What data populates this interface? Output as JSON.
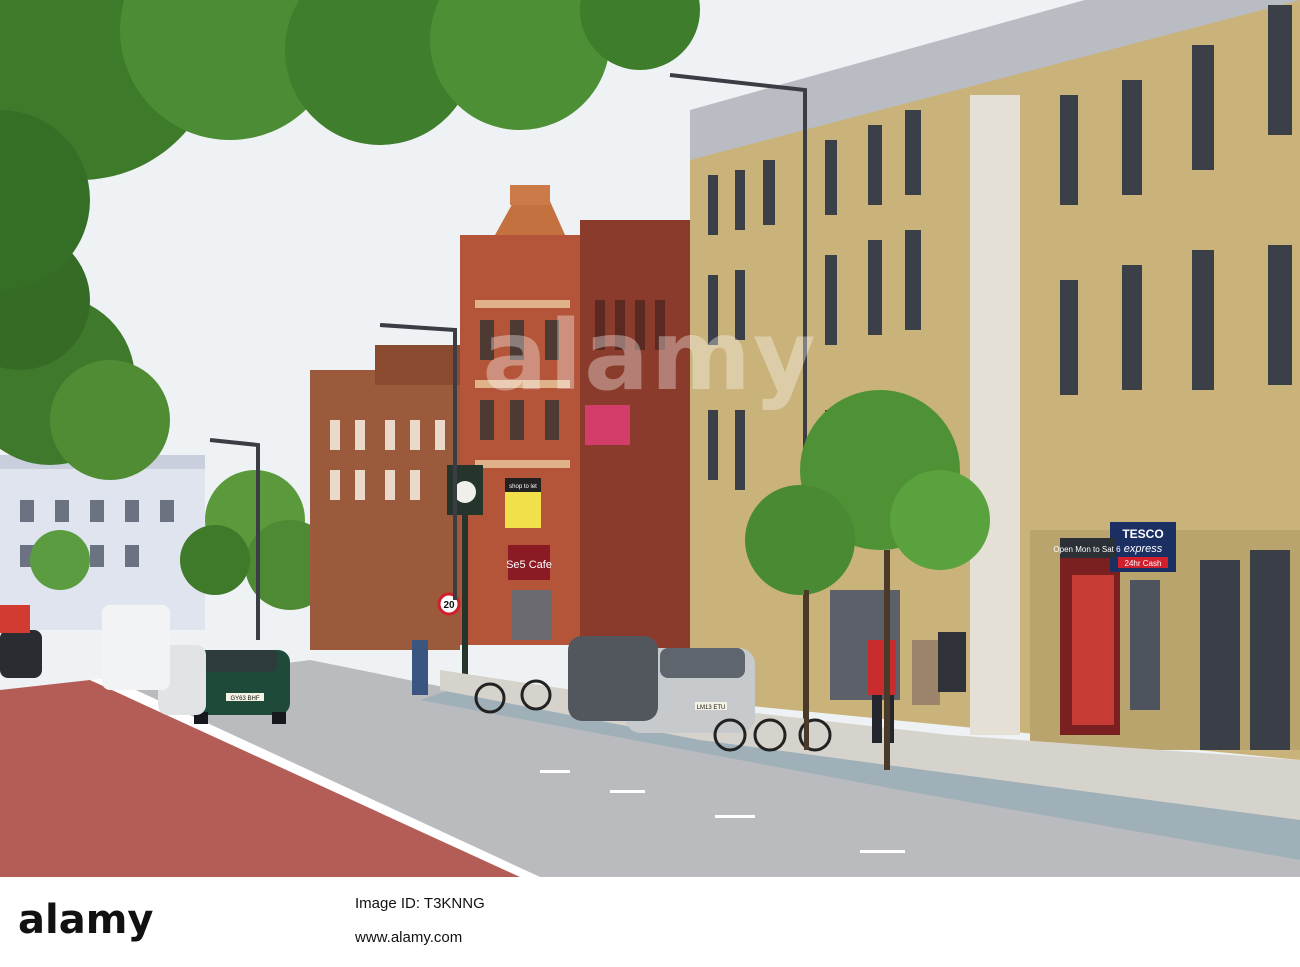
{
  "photo": {
    "signs": {
      "tesco_brand": "TESCO",
      "tesco_sub": "express",
      "tesco_cash": "24hr Cash",
      "cafe": "Se5 Cafe",
      "shop_to_let": "shop to let",
      "open_sign": "Open Mon to Sat 6",
      "speed_limit": "20"
    },
    "plates": {
      "green_car": "GY63 BHF",
      "silver_car": "LM13 ETU"
    },
    "watermark": "alamy"
  },
  "footer": {
    "brand": "alamy",
    "image_id_label": "Image ID: T3KNNG",
    "site": "www.alamy.com"
  }
}
